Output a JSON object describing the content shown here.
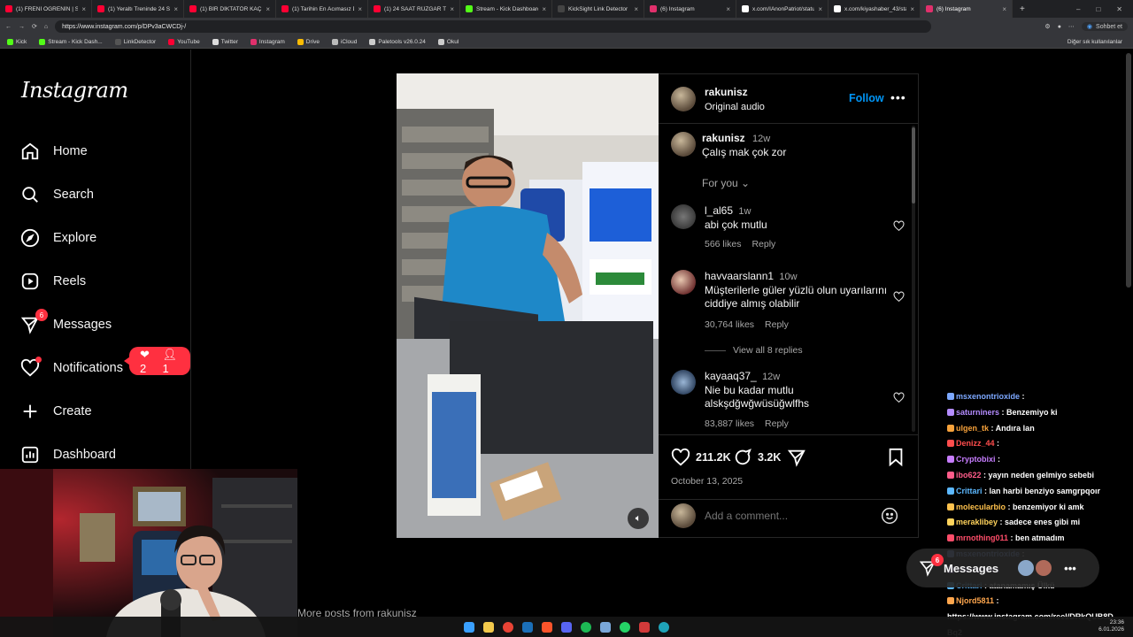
{
  "browser": {
    "tabs": [
      {
        "title": "(1) FRENİ ÖĞRENİN | Sikildeı",
        "color": "#ff0033"
      },
      {
        "title": "(1) Yeraltı Treninde 24 Saat H",
        "color": "#ff0033"
      },
      {
        "title": "(1) BİR DİKTATÖR KAÇIRILIRSA",
        "color": "#ff0033"
      },
      {
        "title": "(1) Tarihin En Acımasız Diktat",
        "color": "#ff0033"
      },
      {
        "title": "(1) 24 SAAT RÜZGAR TÜRBİN",
        "color": "#ff0033"
      },
      {
        "title": "Stream - Kick Dashboard",
        "color": "#53fc18"
      },
      {
        "title": "KickSight Link Detector",
        "color": "#444444"
      },
      {
        "title": "(6) Instagram",
        "color": "#e1306c"
      },
      {
        "title": "x.com/IAnonPatriot/status/20",
        "color": "#ffffff"
      },
      {
        "title": "x.com/kiyashaber_43/status/",
        "color": "#ffffff"
      },
      {
        "title": "(6) Instagram",
        "color": "#e1306c",
        "active": true
      }
    ],
    "url": "https://www.instagram.com/p/DPv3aCWCDj-/",
    "chat_button": "Sohbet et",
    "bookmarks": [
      {
        "label": "Kick",
        "color": "#53fc18"
      },
      {
        "label": "Stream - Kick Dash...",
        "color": "#53fc18"
      },
      {
        "label": "LinkDetector",
        "color": "#555555"
      },
      {
        "label": "YouTube",
        "color": "#ff0033"
      },
      {
        "label": "Twitter",
        "color": "#dddddd"
      },
      {
        "label": "Instagram",
        "color": "#e1306c"
      },
      {
        "label": "Drive",
        "color": "#fbbc04"
      },
      {
        "label": "iCloud",
        "color": "#bbbbbb"
      },
      {
        "label": "Paletools v26.0.24",
        "color": "#cccccc"
      },
      {
        "label": "Okul",
        "color": "#cccccc"
      }
    ],
    "bookmarks_other": "Diğer sık kullanılanlar"
  },
  "sidebar": {
    "logo": "Instagram",
    "items": [
      {
        "label": "Home",
        "icon": "home-icon"
      },
      {
        "label": "Search",
        "icon": "search-icon"
      },
      {
        "label": "Explore",
        "icon": "compass-icon"
      },
      {
        "label": "Reels",
        "icon": "reels-icon"
      },
      {
        "label": "Messages",
        "icon": "messenger-icon",
        "badge": "6"
      },
      {
        "label": "Notifications",
        "icon": "heart-icon"
      },
      {
        "label": "Create",
        "icon": "plus-icon"
      },
      {
        "label": "Dashboard",
        "icon": "dashboard-icon"
      }
    ],
    "notif_pill": {
      "likes": "2",
      "follows": "1"
    }
  },
  "post": {
    "author": "rakunisz",
    "audio": "Original audio",
    "follow": "Follow",
    "caption": {
      "user": "rakunisz",
      "time": "12w",
      "text": "Çalış mak çok zor"
    },
    "for_you": "For you",
    "comments": [
      {
        "user": "l_al65",
        "time": "1w",
        "text": "abi çok mutlu",
        "likes": "566 likes",
        "reply": "Reply"
      },
      {
        "user": "havvaarslann1",
        "time": "10w",
        "text": "Müşterilerle güler yüzlü olun uyarılarını ciddiye almış olabilir",
        "likes": "30,764 likes",
        "reply": "Reply",
        "view_replies": "View all 8 replies"
      },
      {
        "user": "kayaaq37_",
        "time": "12w",
        "text": "Nie bu kadar mutlu alskşdğwğwüsüğwlfhs",
        "likes": "83,887 likes",
        "reply": "Reply"
      }
    ],
    "like_count": "211.2K",
    "comment_count": "3.2K",
    "date": "October 13, 2025",
    "comment_placeholder": "Add a comment..."
  },
  "more_posts": "More posts from rakunisz",
  "chat": [
    {
      "user": "msxenontrioxide",
      "text": " :",
      "color": "#7da8ff"
    },
    {
      "user": "saturniners",
      "text": " : Benzemiyo ki",
      "color": "#b48cff"
    },
    {
      "user": "ulgen_tk",
      "text": " : Andıra lan",
      "color": "#f7a23b"
    },
    {
      "user": "Denizz_44",
      "text": " :",
      "color": "#ff4d4d"
    },
    {
      "user": "Cryptobixi",
      "text": " :",
      "color": "#c77dff"
    },
    {
      "user": "ibo622",
      "text": " : yayın neden gelmiyo sebebi",
      "color": "#ff5c8a"
    },
    {
      "user": "Crittari",
      "text": " : lan harbi benziyo samgrpqoır",
      "color": "#5cb8ff"
    },
    {
      "user": "molecularbio",
      "text": " : benzemiyor ki amk",
      "color": "#ffc24d"
    },
    {
      "user": "meraklibey",
      "text": " : sadece enes gibi mi",
      "color": "#ffd35c"
    },
    {
      "user": "mrnothing011",
      "text": " : ben atmadım",
      "color": "#ff4d6a"
    },
    {
      "user": "msxenontrioxide",
      "text": " :",
      "color": "#7da8ff"
    },
    {
      "user": "saturniners",
      "text": "",
      "color": "#b48cff"
    },
    {
      "user": "Crittari",
      "text": " : atanamamış Ülkü",
      "color": "#5cb8ff"
    },
    {
      "user": "Njord5811",
      "text": " :",
      "color": "#ffa64d"
    },
    {
      "user": "",
      "text": "https://www.instagram.com/reel/DRkQUB8D",
      "color": "#ffffff"
    },
    {
      "user": "",
      "text": "Bq2",
      "color": "#ffffff"
    }
  ],
  "messages_pill": {
    "label": "Messages",
    "badge": "6"
  },
  "tray": {
    "time": "23:36",
    "date": "6.01.2026"
  }
}
